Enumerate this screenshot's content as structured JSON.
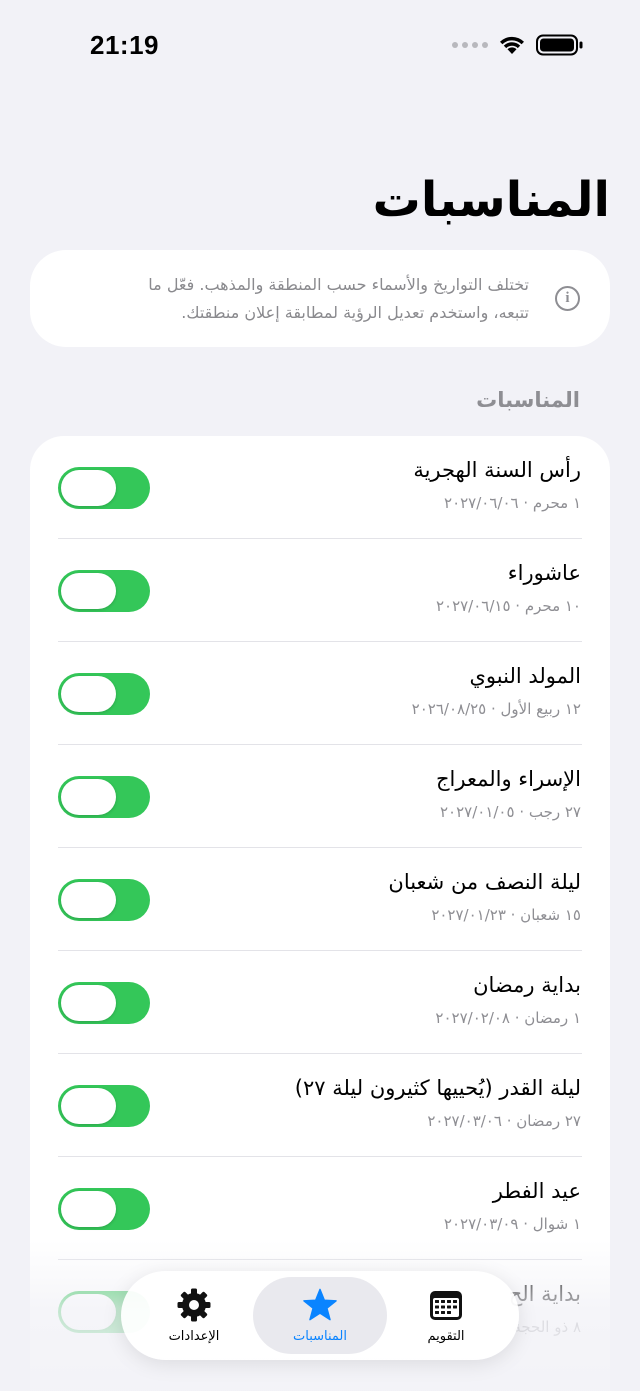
{
  "status_bar": {
    "time": "21:19"
  },
  "page": {
    "title": "المناسبات"
  },
  "info": {
    "icon": "info-icon",
    "line1": "تختلف التواريخ والأسماء حسب المنطقة والمذهب. فعّل ما",
    "line2": "تتبعه، واستخدم تعديل الرؤية لمطابقة إعلان منطقتك."
  },
  "section": {
    "header": "المناسبات"
  },
  "occasions": [
    {
      "title": "رأس السنة الهجرية",
      "subtitle": "١ محرم · ٢٠٢٧/٠٦/٠٦",
      "enabled": true
    },
    {
      "title": "عاشوراء",
      "subtitle": "١٠ محرم · ٢٠٢٧/٠٦/١٥",
      "enabled": true
    },
    {
      "title": "المولد النبوي",
      "subtitle": "١٢ ربيع الأول · ٢٠٢٦/٠٨/٢٥",
      "enabled": true
    },
    {
      "title": "الإسراء والمعراج",
      "subtitle": "٢٧ رجب · ٢٠٢٧/٠١/٠٥",
      "enabled": true
    },
    {
      "title": "ليلة النصف من شعبان",
      "subtitle": "١٥ شعبان · ٢٠٢٧/٠١/٢٣",
      "enabled": true
    },
    {
      "title": "بداية رمضان",
      "subtitle": "١ رمضان · ٢٠٢٧/٠٢/٠٨",
      "enabled": true
    },
    {
      "title": "ليلة القدر (يُحييها كثيرون ليلة ٢٧)",
      "subtitle": "٢٧ رمضان · ٢٠٢٧/٠٣/٠٦",
      "enabled": true
    },
    {
      "title": "عيد الفطر",
      "subtitle": "١ شوال · ٢٠٢٧/٠٣/٠٩",
      "enabled": true
    },
    {
      "title": "بداية الح",
      "subtitle": "٨ ذو الحجة",
      "enabled": true
    }
  ],
  "tab_bar": {
    "tabs": [
      {
        "label": "التقويم",
        "icon": "calendar-icon",
        "active": false
      },
      {
        "label": "المناسبات",
        "icon": "star-icon",
        "active": true
      },
      {
        "label": "الإعدادات",
        "icon": "gear-icon",
        "active": false
      }
    ]
  },
  "colors": {
    "accent": "#0A84FF",
    "toggle_on": "#34C759",
    "background": "#F2F2F7"
  }
}
